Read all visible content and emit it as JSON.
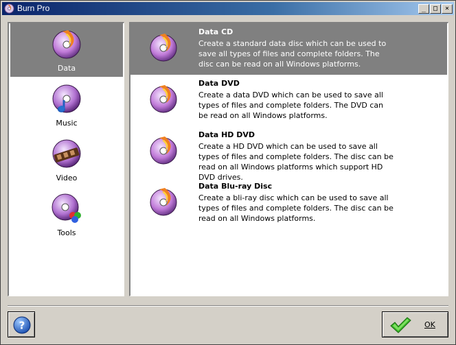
{
  "window": {
    "title": "Burn Pro"
  },
  "caption_buttons": {
    "minimize": "_",
    "maximize": "□",
    "close": "×"
  },
  "categories": [
    {
      "label": "Data",
      "icon": "data-disc-icon",
      "selected": true
    },
    {
      "label": "Music",
      "icon": "music-disc-icon",
      "selected": false
    },
    {
      "label": "Video",
      "icon": "video-disc-icon",
      "selected": false
    },
    {
      "label": "Tools",
      "icon": "tools-disc-icon",
      "selected": false
    }
  ],
  "options": [
    {
      "title": "Data CD",
      "description": "Create a standard data disc which can be used to save all types of files and complete folders. The disc can be read on all Windows platforms.",
      "selected": true
    },
    {
      "title": "Data DVD",
      "description": "Create a data DVD which can be used to save all types of files and complete folders. The DVD can be read on all Windows platforms.",
      "selected": false
    },
    {
      "title": "Data HD DVD",
      "description": "Create a HD DVD which can be used to save all types of files and complete folders. The disc can be read on all Windows platforms which support HD DVD drives.",
      "selected": false
    },
    {
      "title": "Data Blu-ray Disc",
      "description": "Create a bli-ray disc which can be used to save all types of files and complete folders. The disc can be read on all Windows platforms.",
      "selected": false
    }
  ],
  "buttons": {
    "help": "?",
    "ok": "OK"
  },
  "colors": {
    "titlebar": "#0a246a",
    "selection": "#808080",
    "face": "#d4d0c8",
    "check": "#3cb82a",
    "help": "#2a6fd6"
  }
}
